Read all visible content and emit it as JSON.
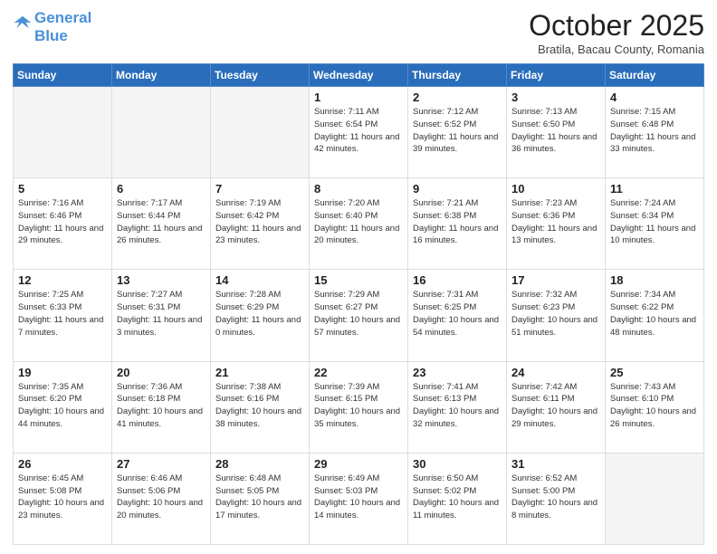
{
  "header": {
    "logo_line1": "General",
    "logo_line2": "Blue",
    "month_title": "October 2025",
    "location": "Bratila, Bacau County, Romania"
  },
  "weekdays": [
    "Sunday",
    "Monday",
    "Tuesday",
    "Wednesday",
    "Thursday",
    "Friday",
    "Saturday"
  ],
  "weeks": [
    [
      {
        "day": "",
        "info": ""
      },
      {
        "day": "",
        "info": ""
      },
      {
        "day": "",
        "info": ""
      },
      {
        "day": "1",
        "info": "Sunrise: 7:11 AM\nSunset: 6:54 PM\nDaylight: 11 hours and 42 minutes."
      },
      {
        "day": "2",
        "info": "Sunrise: 7:12 AM\nSunset: 6:52 PM\nDaylight: 11 hours and 39 minutes."
      },
      {
        "day": "3",
        "info": "Sunrise: 7:13 AM\nSunset: 6:50 PM\nDaylight: 11 hours and 36 minutes."
      },
      {
        "day": "4",
        "info": "Sunrise: 7:15 AM\nSunset: 6:48 PM\nDaylight: 11 hours and 33 minutes."
      }
    ],
    [
      {
        "day": "5",
        "info": "Sunrise: 7:16 AM\nSunset: 6:46 PM\nDaylight: 11 hours and 29 minutes."
      },
      {
        "day": "6",
        "info": "Sunrise: 7:17 AM\nSunset: 6:44 PM\nDaylight: 11 hours and 26 minutes."
      },
      {
        "day": "7",
        "info": "Sunrise: 7:19 AM\nSunset: 6:42 PM\nDaylight: 11 hours and 23 minutes."
      },
      {
        "day": "8",
        "info": "Sunrise: 7:20 AM\nSunset: 6:40 PM\nDaylight: 11 hours and 20 minutes."
      },
      {
        "day": "9",
        "info": "Sunrise: 7:21 AM\nSunset: 6:38 PM\nDaylight: 11 hours and 16 minutes."
      },
      {
        "day": "10",
        "info": "Sunrise: 7:23 AM\nSunset: 6:36 PM\nDaylight: 11 hours and 13 minutes."
      },
      {
        "day": "11",
        "info": "Sunrise: 7:24 AM\nSunset: 6:34 PM\nDaylight: 11 hours and 10 minutes."
      }
    ],
    [
      {
        "day": "12",
        "info": "Sunrise: 7:25 AM\nSunset: 6:33 PM\nDaylight: 11 hours and 7 minutes."
      },
      {
        "day": "13",
        "info": "Sunrise: 7:27 AM\nSunset: 6:31 PM\nDaylight: 11 hours and 3 minutes."
      },
      {
        "day": "14",
        "info": "Sunrise: 7:28 AM\nSunset: 6:29 PM\nDaylight: 11 hours and 0 minutes."
      },
      {
        "day": "15",
        "info": "Sunrise: 7:29 AM\nSunset: 6:27 PM\nDaylight: 10 hours and 57 minutes."
      },
      {
        "day": "16",
        "info": "Sunrise: 7:31 AM\nSunset: 6:25 PM\nDaylight: 10 hours and 54 minutes."
      },
      {
        "day": "17",
        "info": "Sunrise: 7:32 AM\nSunset: 6:23 PM\nDaylight: 10 hours and 51 minutes."
      },
      {
        "day": "18",
        "info": "Sunrise: 7:34 AM\nSunset: 6:22 PM\nDaylight: 10 hours and 48 minutes."
      }
    ],
    [
      {
        "day": "19",
        "info": "Sunrise: 7:35 AM\nSunset: 6:20 PM\nDaylight: 10 hours and 44 minutes."
      },
      {
        "day": "20",
        "info": "Sunrise: 7:36 AM\nSunset: 6:18 PM\nDaylight: 10 hours and 41 minutes."
      },
      {
        "day": "21",
        "info": "Sunrise: 7:38 AM\nSunset: 6:16 PM\nDaylight: 10 hours and 38 minutes."
      },
      {
        "day": "22",
        "info": "Sunrise: 7:39 AM\nSunset: 6:15 PM\nDaylight: 10 hours and 35 minutes."
      },
      {
        "day": "23",
        "info": "Sunrise: 7:41 AM\nSunset: 6:13 PM\nDaylight: 10 hours and 32 minutes."
      },
      {
        "day": "24",
        "info": "Sunrise: 7:42 AM\nSunset: 6:11 PM\nDaylight: 10 hours and 29 minutes."
      },
      {
        "day": "25",
        "info": "Sunrise: 7:43 AM\nSunset: 6:10 PM\nDaylight: 10 hours and 26 minutes."
      }
    ],
    [
      {
        "day": "26",
        "info": "Sunrise: 6:45 AM\nSunset: 5:08 PM\nDaylight: 10 hours and 23 minutes."
      },
      {
        "day": "27",
        "info": "Sunrise: 6:46 AM\nSunset: 5:06 PM\nDaylight: 10 hours and 20 minutes."
      },
      {
        "day": "28",
        "info": "Sunrise: 6:48 AM\nSunset: 5:05 PM\nDaylight: 10 hours and 17 minutes."
      },
      {
        "day": "29",
        "info": "Sunrise: 6:49 AM\nSunset: 5:03 PM\nDaylight: 10 hours and 14 minutes."
      },
      {
        "day": "30",
        "info": "Sunrise: 6:50 AM\nSunset: 5:02 PM\nDaylight: 10 hours and 11 minutes."
      },
      {
        "day": "31",
        "info": "Sunrise: 6:52 AM\nSunset: 5:00 PM\nDaylight: 10 hours and 8 minutes."
      },
      {
        "day": "",
        "info": ""
      }
    ]
  ]
}
